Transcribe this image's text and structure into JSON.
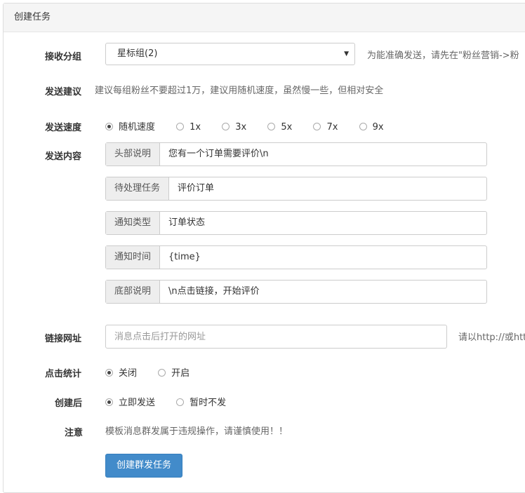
{
  "panel": {
    "title": "创建任务"
  },
  "receive_group": {
    "label": "接收分组",
    "selected": "星标组(2)",
    "hint": "为能准确发送，请先在\"粉丝营销->粉"
  },
  "suggestion": {
    "label": "发送建议",
    "text": "建议每组粉丝不要超过1万，建议用随机速度，虽然慢一些，但相对安全"
  },
  "speed": {
    "label": "发送速度",
    "options": [
      "随机速度",
      "1x",
      "3x",
      "5x",
      "7x",
      "9x"
    ],
    "selected": "随机速度"
  },
  "content": {
    "label": "发送内容",
    "fields": [
      {
        "addon": "头部说明",
        "value": "您有一个订单需要评价\\n"
      },
      {
        "addon": "待处理任务",
        "value": "评价订单"
      },
      {
        "addon": "通知类型",
        "value": "订单状态"
      },
      {
        "addon": "通知时间",
        "value": "{time}"
      },
      {
        "addon": "底部说明",
        "value": "\\n点击链接，开始评价"
      }
    ]
  },
  "link": {
    "label": "链接网址",
    "value": "",
    "placeholder": "消息点击后打开的网址",
    "hint": "请以http://或htt"
  },
  "click_stats": {
    "label": "点击统计",
    "options": [
      "关闭",
      "开启"
    ],
    "selected": "关闭"
  },
  "after_create": {
    "label": "创建后",
    "options": [
      "立即发送",
      "暂时不发"
    ],
    "selected": "立即发送"
  },
  "notice": {
    "label": "注意",
    "text": "模板消息群发属于违规操作，请谨慎使用！！"
  },
  "submit": {
    "label": "创建群发任务"
  },
  "colors": {
    "primary": "#428bca",
    "addon_bg": "#eeeeee",
    "border": "#cccccc"
  }
}
